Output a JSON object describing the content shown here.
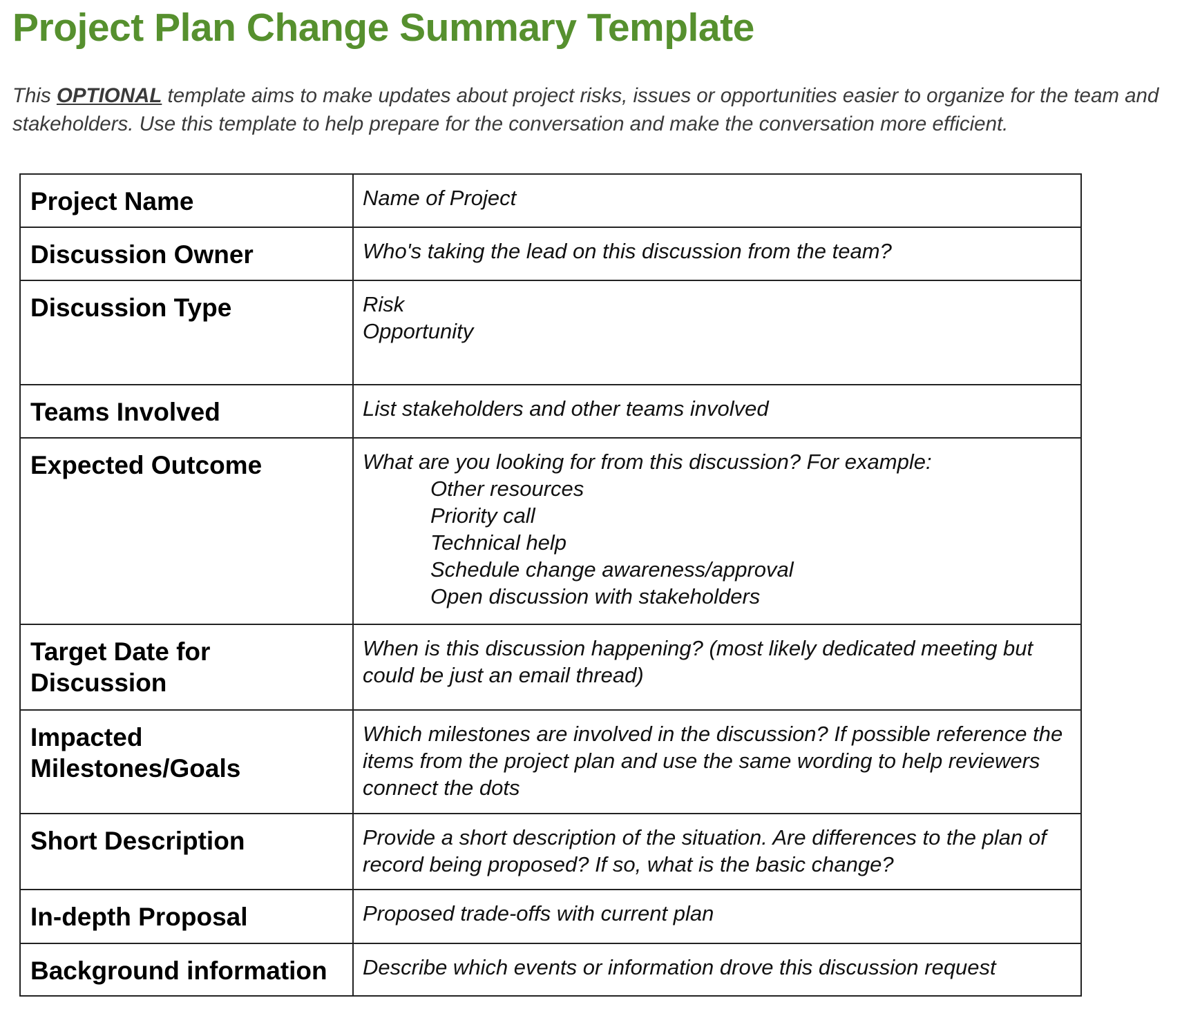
{
  "title": "Project Plan Change Summary Template",
  "intro": {
    "before": "This ",
    "emphasis": "OPTIONAL",
    "after": " template aims to make updates about project risks, issues or opportunities easier to organize for the team and stakeholders. Use this template to help prepare for the conversation and make the conversation more efficient."
  },
  "rows": [
    {
      "label": "Project Name",
      "value": "Name of Project"
    },
    {
      "label": "Discussion Owner",
      "value": "Who's taking the lead on this discussion from the team?"
    },
    {
      "label": "Discussion Type",
      "options": [
        "Risk",
        "Opportunity"
      ]
    },
    {
      "label": "Teams Involved",
      "value": "List stakeholders and other teams involved"
    },
    {
      "label": "Expected Outcome",
      "value": "What are you looking for from this discussion? For example:",
      "examples": [
        "Other resources",
        "Priority call",
        "Technical help",
        "Schedule change awareness/approval",
        "Open discussion with stakeholders"
      ]
    },
    {
      "label": "Target Date for Discussion",
      "value": "When is this discussion happening? (most likely dedicated meeting but could be just an email thread)"
    },
    {
      "label": "Impacted Milestones/Goals",
      "value": "Which milestones are involved in the discussion? If possible reference the items from the project plan and use the same wording to help reviewers connect the dots"
    },
    {
      "label": "Short Description",
      "value": "Provide a short description of the situation. Are differences to the plan of record being proposed? If so, what is the basic change?"
    },
    {
      "label": "In-depth Proposal",
      "value": "Proposed trade-offs with current plan"
    },
    {
      "label": "Background information",
      "value": "Describe which events or information drove this discussion request"
    }
  ]
}
